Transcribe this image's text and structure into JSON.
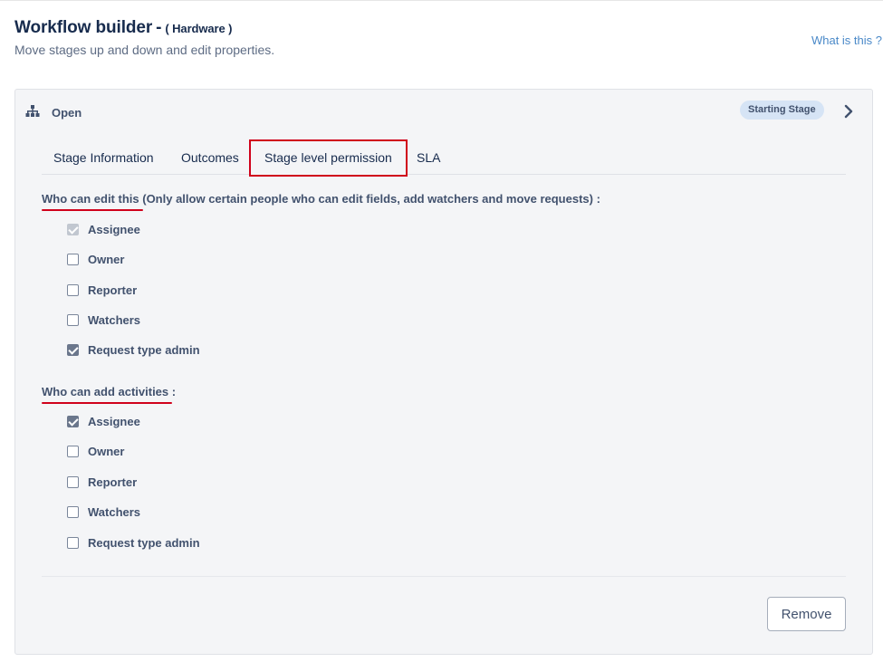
{
  "page": {
    "title": "Workflow builder",
    "title_separator": "-",
    "project": "( Hardware )",
    "subtitle": "Move stages up and down and edit properties.",
    "help_link": "What is this ?"
  },
  "stage": {
    "name": "Open",
    "icon": "hierarchy-icon",
    "badge": "Starting Stage",
    "expand_icon": "chevron-right-icon"
  },
  "tabs": [
    {
      "label": "Stage Information",
      "active": false
    },
    {
      "label": "Outcomes",
      "active": false
    },
    {
      "label": "Stage level permission",
      "active": true
    },
    {
      "label": "SLA",
      "active": false
    }
  ],
  "permissions": {
    "edit": {
      "title": "Who can edit this",
      "title_suffix": " (Only allow certain people who can edit fields, add watchers and move requests) :",
      "options": [
        {
          "label": "Assignee",
          "checked": true,
          "disabled": true
        },
        {
          "label": "Owner",
          "checked": false,
          "disabled": false
        },
        {
          "label": "Reporter",
          "checked": false,
          "disabled": false
        },
        {
          "label": "Watchers",
          "checked": false,
          "disabled": false
        },
        {
          "label": "Request type admin",
          "checked": true,
          "disabled": false
        }
      ]
    },
    "activities": {
      "title": "Who can add activities",
      "title_suffix": " :",
      "options": [
        {
          "label": "Assignee",
          "checked": true,
          "disabled": false
        },
        {
          "label": "Owner",
          "checked": false,
          "disabled": false
        },
        {
          "label": "Reporter",
          "checked": false,
          "disabled": false
        },
        {
          "label": "Watchers",
          "checked": false,
          "disabled": false
        },
        {
          "label": "Request type admin",
          "checked": false,
          "disabled": false
        }
      ]
    }
  },
  "actions": {
    "remove_label": "Remove"
  },
  "colors": {
    "accent_red": "#d0021b",
    "link_blue": "#4a89c8",
    "badge_bg": "#d6e4f5",
    "checkbox_checked": "#6b778c"
  }
}
